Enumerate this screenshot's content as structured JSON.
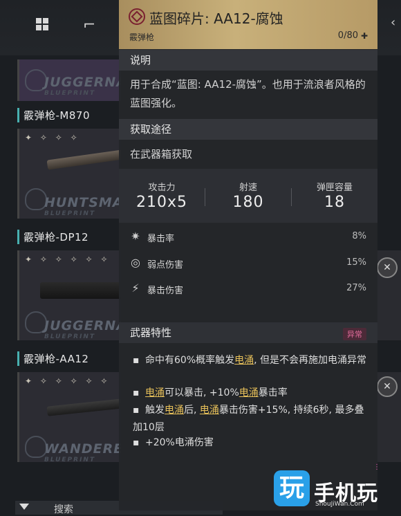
{
  "background": {
    "cards": [
      {
        "title": "",
        "brand": "JUGGERNAUT",
        "brand_sub": "BLUEPRINT",
        "stars": ""
      },
      {
        "title": "霰弹枪-M870",
        "brand": "HUNTSMAN",
        "brand_sub": "BLUEPRINT",
        "stars": "✦ ✧ ✧ ✧"
      },
      {
        "title": "霰弹枪-DP12",
        "brand": "JUGGERNAUT",
        "brand_sub": "BLUEPRINT",
        "stars": "✦ ✧ ✧ ✧ ✧ ✧"
      },
      {
        "title": "霰弹枪-AA12",
        "brand": "WANDERER",
        "brand_sub": "BLUEPRINT",
        "stars": "✦ ✧ ✧ ✧ ✧ ✧"
      }
    ],
    "search_label": "搜索"
  },
  "tooltip": {
    "title": "蓝图碎片: AA12-腐蚀",
    "subtitle": "霰弹枪",
    "count": "0/80",
    "section_desc": "说明",
    "desc_text": "用于合成“蓝图: AA12-腐蚀”。也用于流浪者风格的蓝图强化。",
    "section_source": "获取途径",
    "source_text": "在武器箱获取",
    "stats": [
      {
        "label": "攻击力",
        "value": "210x5"
      },
      {
        "label": "射速",
        "value": "180"
      },
      {
        "label": "弹匣容量",
        "value": "18"
      }
    ],
    "attributes": [
      {
        "icon": "✷",
        "name": "暴击率",
        "value": "8%"
      },
      {
        "icon": "◎",
        "name": "弱点伤害",
        "value": "15%"
      },
      {
        "icon": "⚡",
        "name": "暴击伤害",
        "value": "27%"
      }
    ],
    "section_traits": "武器特性",
    "traits_badge": "异常",
    "traits": [
      {
        "parts": [
          "命中有60%概率触发",
          "电涌",
          ", 但是不会再施加电涌异常"
        ]
      },
      {
        "parts": [
          "",
          "电涌",
          "可以暴击, +10%",
          "电涌",
          "暴击率"
        ]
      },
      {
        "parts": [
          "触发",
          "电涌",
          "后, ",
          "电涌",
          "暴击伤害+15%, 持续6秒, 最多叠加10层"
        ]
      },
      {
        "parts": [
          "+20%电涌伤害"
        ]
      }
    ]
  },
  "watermark": {
    "logo_char": "玩",
    "text": "手机玩",
    "url": "ShouJiWan.Com"
  }
}
